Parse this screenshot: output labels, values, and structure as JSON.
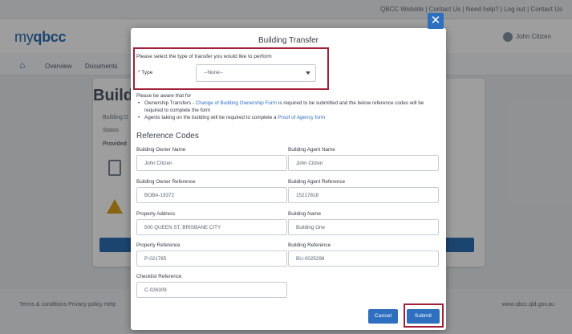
{
  "background": {
    "top_links": "QBCC Website | Contact Us | Need help? | Log out | Contact Us",
    "logo_prefix": "my",
    "logo_brand": "qbcc",
    "user_name": "John Citizen",
    "nav_items": [
      "Overview",
      "Documents"
    ],
    "card_title": "Build",
    "side_labels": [
      "Building D",
      "Status",
      "Provided"
    ],
    "footer_links": "Terms & conditions    Privacy policy    Help",
    "footer_right": "www.qbcc.qld.gov.au"
  },
  "modal": {
    "title": "Building Transfer",
    "close_symbol": "✕",
    "type_prompt": "Please select the type of transfer you would like to perform",
    "type_label": "* Type",
    "type_value": "--None--",
    "info_intro": "Please be aware that for",
    "info_item1_prefix": "Ownership Transfers - ",
    "info_item1_link": "Change of Building Ownership Form",
    "info_item1_suffix": " is required to be submitted and the below reference codes will be required to complete the form",
    "info_item2_prefix": "Agents taking on the building will be required to complete a ",
    "info_item2_link": "Proof of Agency form",
    "reference_heading": "Reference Codes",
    "fields": {
      "owner_name": {
        "label": "Building Owner Name",
        "value": "John Citizen"
      },
      "agent_name": {
        "label": "Building Agent Name",
        "value": "John Citzen"
      },
      "owner_ref": {
        "label": "Building Owner Reference",
        "value": "BOBA-19372"
      },
      "agent_ref": {
        "label": "Building Agent Reference",
        "value": "15217818"
      },
      "property_address": {
        "label": "Property Address",
        "value": "500 QUEEN ST, BRISBANE CITY"
      },
      "building_name": {
        "label": "Building Name",
        "value": "Building One"
      },
      "property_ref": {
        "label": "Property Reference",
        "value": "P-021785"
      },
      "building_ref": {
        "label": "Building Reference",
        "value": "BU-0025298"
      },
      "checklist_ref": {
        "label": "Checklist Reference",
        "value": "C-026309"
      }
    },
    "cancel_label": "Cancel",
    "submit_label": "Submit"
  },
  "colors": {
    "accent": "#2f6fc0",
    "highlight_box": "#a3203a"
  }
}
